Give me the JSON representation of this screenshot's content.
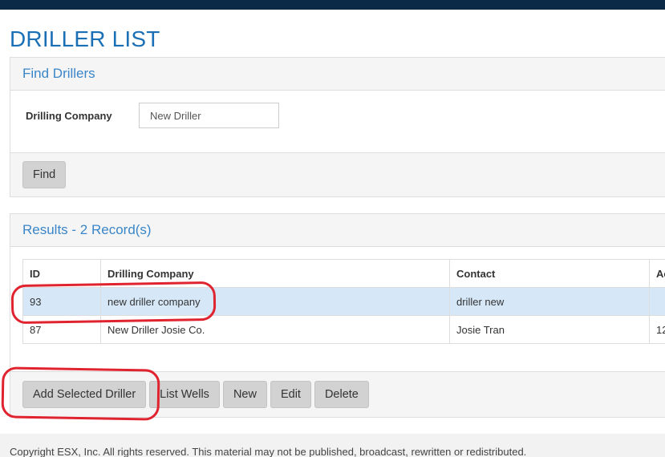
{
  "page": {
    "title": "DRILLER LIST"
  },
  "find_panel": {
    "heading": "Find Drillers",
    "filter_label": "Drilling Company",
    "filter_value": "New Driller",
    "find_label": "Find"
  },
  "results_panel": {
    "heading": "Results - 2 Record(s)",
    "columns": [
      "ID",
      "Drilling Company",
      "Contact",
      "Ac"
    ],
    "rows": [
      {
        "id": "93",
        "company": "new driller company",
        "contact": "driller new",
        "extra": "",
        "selected": true
      },
      {
        "id": "87",
        "company": "New Driller Josie Co.",
        "contact": "Josie Tran",
        "extra": "12",
        "selected": false
      }
    ],
    "actions": {
      "add_selected": "Add Selected Driller",
      "list_wells": "List Wells",
      "new": "New",
      "edit": "Edit",
      "delete": "Delete"
    }
  },
  "footer": {
    "copyright": "Copyright ESX, Inc. All rights reserved. This material may not be published, broadcast, rewritten or redistributed."
  },
  "colors": {
    "header_bar": "#0b2a47",
    "title_blue": "#1a6fb5",
    "selected_row": "#d6e8f8",
    "annotation_red": "#e0242f"
  }
}
